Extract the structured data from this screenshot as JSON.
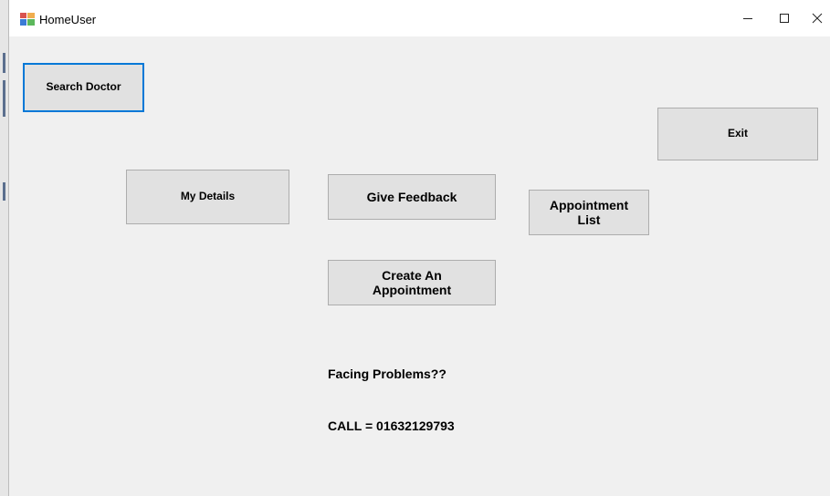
{
  "window": {
    "title": "HomeUser",
    "controls": {
      "minimize": "—",
      "maximize": "☐",
      "close": "✕"
    }
  },
  "buttons": {
    "search_doctor": "Search Doctor",
    "exit": "Exit",
    "my_details": "My Details",
    "give_feedback": "Give Feedback",
    "appointment_list": "Appointment\nList",
    "create_appointment": "Create An\nAppointment"
  },
  "labels": {
    "facing_problems": "Facing Problems??",
    "call": "CALL = 01632129793"
  },
  "colors": {
    "form_background": "#f0f0f0",
    "button_face": "#e1e1e1",
    "focus_border": "#0078d7"
  }
}
